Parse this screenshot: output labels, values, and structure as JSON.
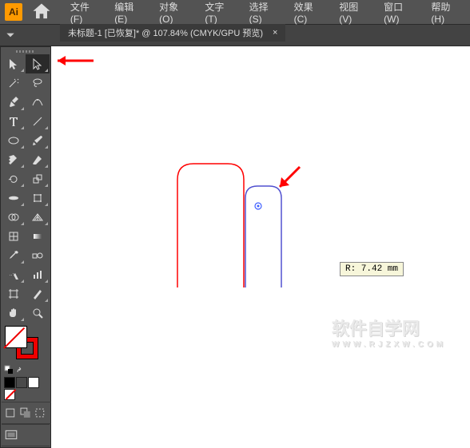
{
  "app": {
    "logo_text": "Ai"
  },
  "menu": {
    "items": [
      "文件(F)",
      "编辑(E)",
      "对象(O)",
      "文字(T)",
      "选择(S)",
      "效果(C)",
      "视图(V)",
      "窗口(W)",
      "帮助(H)"
    ]
  },
  "tab": {
    "title": "未标题-1 [已恢复]* @ 107.84% (CMYK/GPU 预览)",
    "close": "×"
  },
  "tools": {
    "names": [
      "selection-tool",
      "direct-selection-tool",
      "magic-wand-tool",
      "lasso-tool",
      "pen-tool",
      "curvature-tool",
      "type-tool",
      "line-segment-tool",
      "rectangle-tool",
      "paintbrush-tool",
      "shaper-tool",
      "eraser-tool",
      "rotate-tool",
      "scale-tool",
      "width-tool",
      "free-transform-tool",
      "shape-builder-tool",
      "perspective-grid-tool",
      "mesh-tool",
      "gradient-tool",
      "eyedropper-tool",
      "blend-tool",
      "symbol-sprayer-tool",
      "column-graph-tool",
      "artboard-tool",
      "slice-tool",
      "hand-tool",
      "zoom-tool"
    ]
  },
  "swatches": {
    "colors": [
      "#000000",
      "#4a4a4a",
      "#ffffff"
    ]
  },
  "measure": {
    "label": "R: 7.42 mm"
  },
  "watermark": {
    "main": "软件自学网",
    "sub": "WWW.RJZXW.COM"
  },
  "canvas": {
    "shape1": {
      "stroke": "#ff0000"
    },
    "shape2": {
      "stroke": "#5050d0"
    },
    "corner_widget": {
      "color": "#4060ff"
    }
  }
}
